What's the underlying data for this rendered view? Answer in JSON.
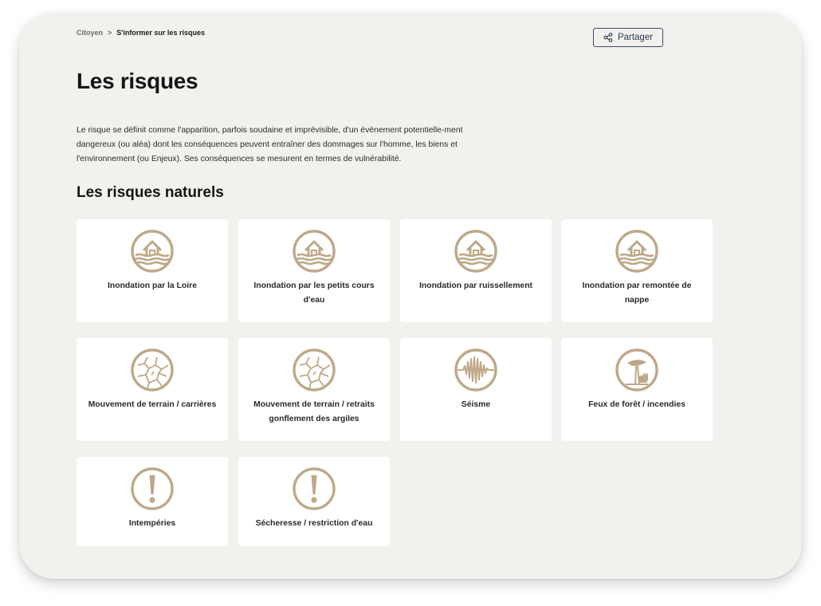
{
  "breadcrumb": {
    "parent": "Citoyen",
    "separator": ">",
    "current": "S'informer sur les risques"
  },
  "share": {
    "label": "Partager",
    "icon": "share-icon"
  },
  "page": {
    "title": "Les risques",
    "intro": "Le risque se définit comme l'apparition, parfois soudaine et imprévisible, d'un évènement potentielle-ment dangereux (ou aléa) dont les conséquences peuvent entraîner des dommages sur l'homme, les biens et l'environnement (ou Enjeux). Ses conséquences se mesurent en termes de vulnérabilité."
  },
  "section": {
    "title": "Les risques naturels"
  },
  "colors": {
    "icon": "#bda888",
    "background": "#f2f1ee",
    "card": "#ffffff"
  },
  "cards": [
    {
      "label": "Inondation par la Loire",
      "icon": "flood-icon"
    },
    {
      "label": "Inondation par les petits cours d'eau",
      "icon": "flood-icon"
    },
    {
      "label": "Inondation par ruissellement",
      "icon": "flood-icon"
    },
    {
      "label": "Inondation par remontée de nappe",
      "icon": "flood-icon"
    },
    {
      "label": "Mouvement de terrain / carrières",
      "icon": "cracked-ground-icon"
    },
    {
      "label": "Mouvement de terrain / retraits gonflement des argiles",
      "icon": "cracked-ground-icon"
    },
    {
      "label": "Séisme",
      "icon": "seismic-wave-icon"
    },
    {
      "label": "Feux de forêt / incendies",
      "icon": "forest-fire-icon"
    },
    {
      "label": "Intempéries",
      "icon": "exclamation-icon"
    },
    {
      "label": "Sécheresse / restriction d'eau",
      "icon": "exclamation-icon"
    }
  ]
}
